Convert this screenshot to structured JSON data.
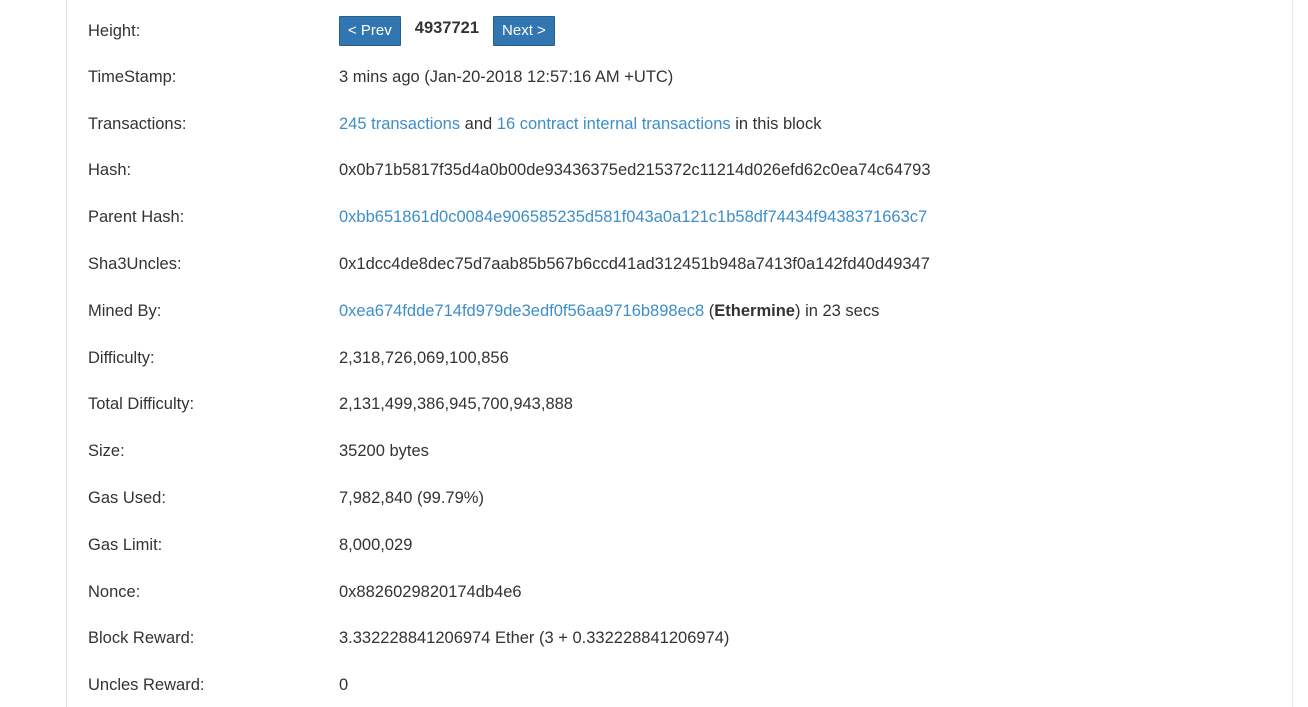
{
  "height": {
    "label": "Height:",
    "prev_label": "< Prev",
    "value": "4937721",
    "next_label": "Next >"
  },
  "timestamp": {
    "label": "TimeStamp:",
    "value": "3 mins ago (Jan-20-2018 12:57:16 AM +UTC)"
  },
  "transactions": {
    "label": "Transactions:",
    "tx_link": "245 transactions",
    "and_text": " and ",
    "internal_link": "16 contract internal transactions",
    "suffix": " in this block"
  },
  "hash": {
    "label": "Hash:",
    "value": "0x0b71b5817f35d4a0b00de93436375ed215372c11214d026efd62c0ea74c64793"
  },
  "parent_hash": {
    "label": "Parent Hash:",
    "value": "0xbb651861d0c0084e906585235d581f043a0a121c1b58df74434f9438371663c7"
  },
  "sha3uncles": {
    "label": "Sha3Uncles:",
    "value": "0x1dcc4de8dec75d7aab85b567b6ccd41ad312451b948a7413f0a142fd40d49347"
  },
  "mined_by": {
    "label": "Mined By:",
    "address": "0xea674fdde714fd979de3edf0f56aa9716b898ec8",
    "open_paren": " (",
    "miner_name": "Ethermine",
    "suffix": ") in 23 secs"
  },
  "difficulty": {
    "label": "Difficulty:",
    "value": "2,318,726,069,100,856"
  },
  "total_difficulty": {
    "label": "Total Difficulty:",
    "value": "2,131,499,386,945,700,943,888"
  },
  "size": {
    "label": "Size:",
    "value": "35200 bytes"
  },
  "gas_used": {
    "label": "Gas Used:",
    "value": "7,982,840 (99.79%)"
  },
  "gas_limit": {
    "label": "Gas Limit:",
    "value": "8,000,029"
  },
  "nonce": {
    "label": "Nonce:",
    "value": "0x8826029820174db4e6"
  },
  "block_reward": {
    "label": "Block Reward:",
    "value": "3.332228841206974 Ether (3 + 0.332228841206974)"
  },
  "uncles_reward": {
    "label": "Uncles Reward:",
    "value": "0"
  },
  "colors": {
    "link": "#3d8ec9",
    "button": "#3276b1",
    "text": "#333333"
  }
}
